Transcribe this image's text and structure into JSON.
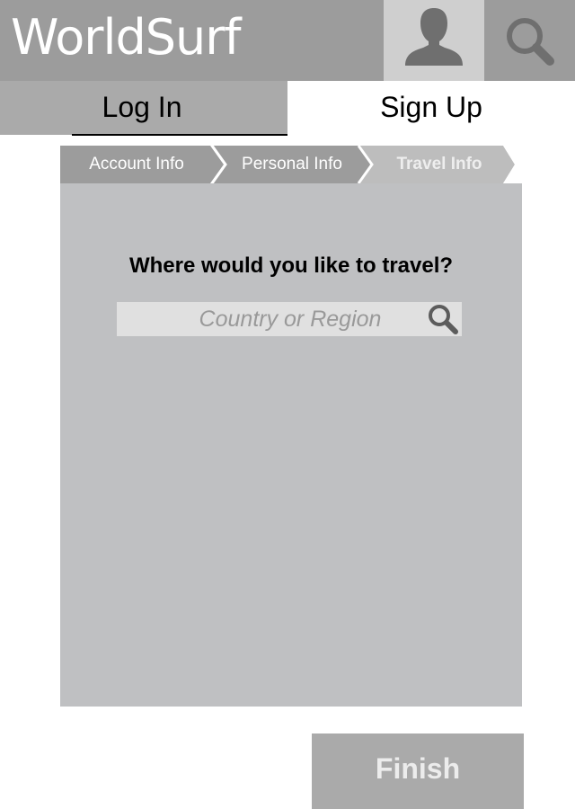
{
  "header": {
    "app_title": "WorldSurf",
    "profile_icon": "user-icon",
    "search_icon": "search-icon"
  },
  "tabs": [
    {
      "label": "Log In",
      "active": false
    },
    {
      "label": "Sign Up",
      "active": true
    }
  ],
  "steps": [
    {
      "label": "Account Info",
      "state": "completed"
    },
    {
      "label": "Personal Info",
      "state": "completed"
    },
    {
      "label": "Travel Info",
      "state": "current"
    }
  ],
  "travel": {
    "question": "Where would you like to travel?",
    "search_placeholder": "Country or Region",
    "search_value": ""
  },
  "actions": {
    "finish_label": "Finish"
  },
  "colors": {
    "header_bg": "#9c9c9c",
    "profile_bg": "#cfcfcf",
    "tab_inactive_bg": "#aaaaaa",
    "step_bg": "#9c9c9c",
    "step_current_bg": "#bdbdbd",
    "panel_bg": "#bfc0c2",
    "field_bg": "#e0e0e0",
    "finish_bg": "#aaaaaa"
  }
}
